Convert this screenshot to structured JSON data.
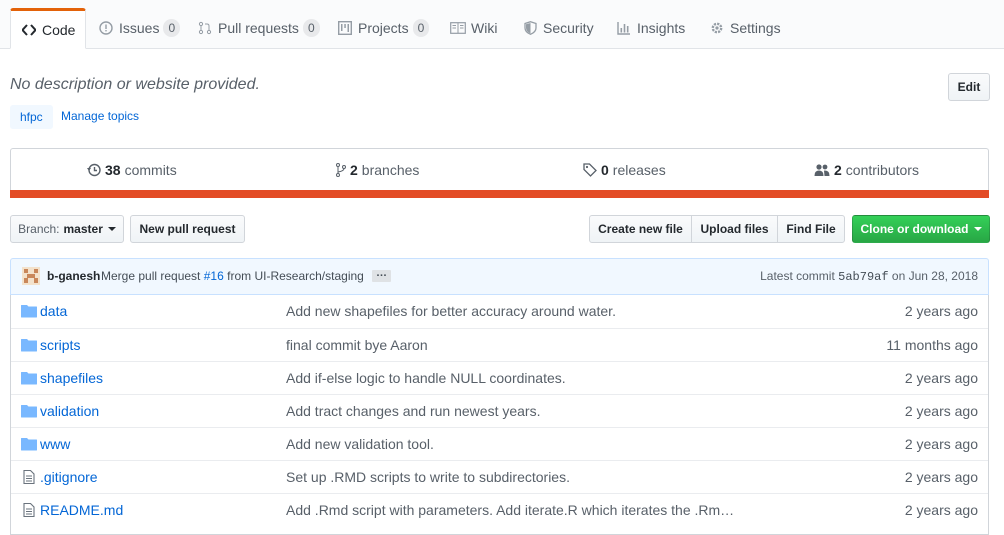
{
  "nav": {
    "tabs": [
      {
        "label": "Code",
        "icon": "code-icon",
        "counter": null
      },
      {
        "label": "Issues",
        "icon": "issue-opened-icon",
        "counter": "0"
      },
      {
        "label": "Pull requests",
        "icon": "git-pull-request-icon",
        "counter": "0"
      },
      {
        "label": "Projects",
        "icon": "project-icon",
        "counter": "0"
      },
      {
        "label": "Wiki",
        "icon": "book-icon",
        "counter": null
      },
      {
        "label": "Security",
        "icon": "shield-icon",
        "counter": null
      },
      {
        "label": "Insights",
        "icon": "graph-icon",
        "counter": null
      },
      {
        "label": "Settings",
        "icon": "gear-icon",
        "counter": null
      }
    ]
  },
  "repo": {
    "description": "No description or website provided.",
    "edit_label": "Edit",
    "topic": "hfpc",
    "manage_topics": "Manage topics"
  },
  "summary": {
    "commits_count": "38",
    "commits_label": "commits",
    "branches_count": "2",
    "branches_label": "branches",
    "releases_count": "0",
    "releases_label": "releases",
    "contributors_count": "2",
    "contributors_label": "contributors",
    "language_color": "#e34c26"
  },
  "toolbar": {
    "branch_prefix": "Branch:",
    "branch_name": "master",
    "new_pr": "New pull request",
    "create_file": "Create new file",
    "upload_files": "Upload files",
    "find_file": "Find File",
    "clone": "Clone or download"
  },
  "latest_commit": {
    "author": "b-ganesh",
    "message_prefix": "Merge pull request",
    "pr_link": "#16",
    "message_suffix": "from UI-Research/staging",
    "ellipsis": "…",
    "label": "Latest commit",
    "sha": "5ab79af",
    "date": "on Jun 28, 2018"
  },
  "files": [
    {
      "name": "data",
      "type": "folder",
      "message": "Add new shapefiles for better accuracy around water.",
      "age": "2 years ago"
    },
    {
      "name": "scripts",
      "type": "folder",
      "message": "final commit bye Aaron",
      "age": "11 months ago"
    },
    {
      "name": "shapefiles",
      "type": "folder",
      "message": "Add if-else logic to handle NULL coordinates.",
      "age": "2 years ago"
    },
    {
      "name": "validation",
      "type": "folder",
      "message": "Add tract changes and run newest years.",
      "age": "2 years ago"
    },
    {
      "name": "www",
      "type": "folder",
      "message": "Add new validation tool.",
      "age": "2 years ago"
    },
    {
      "name": ".gitignore",
      "type": "file",
      "message": "Set up .RMD scripts to write to subdirectories.",
      "age": "2 years ago"
    },
    {
      "name": "README.md",
      "type": "file",
      "message": "Add .Rmd script with parameters. Add iterate.R which iterates the .Rm…",
      "age": "2 years ago"
    }
  ]
}
